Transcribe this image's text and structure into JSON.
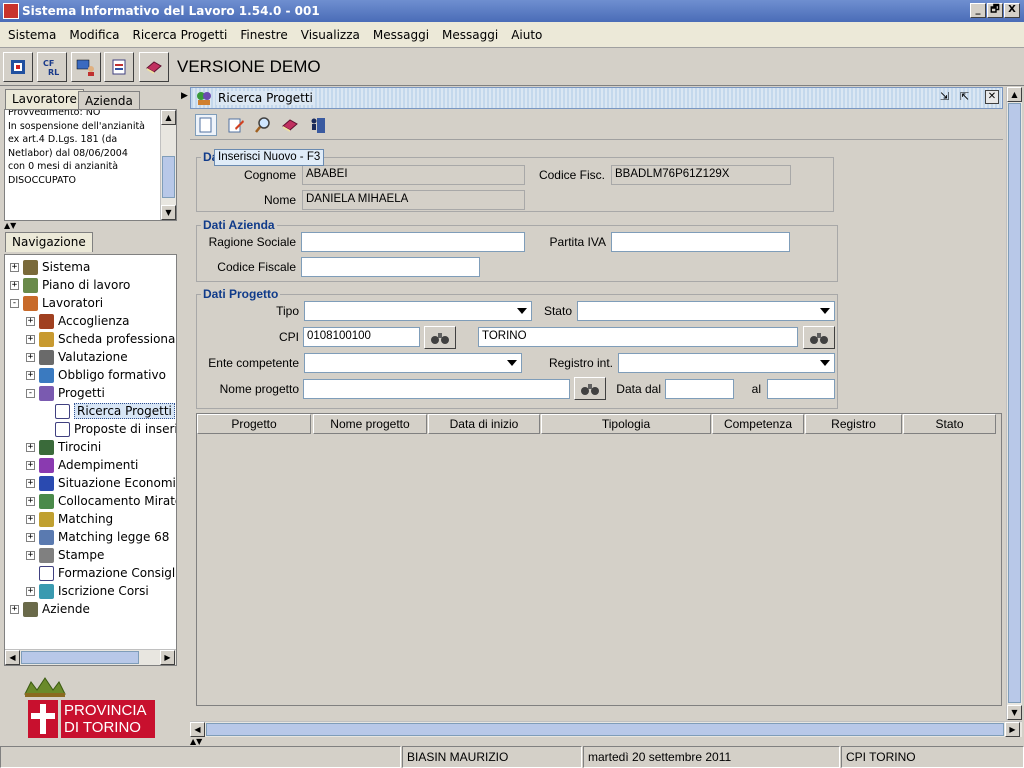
{
  "window": {
    "title": "Sistema Informativo del Lavoro 1.54.0 - 001",
    "minimize": "_",
    "maximize": "🗗",
    "close": "X"
  },
  "menu": [
    "Sistema",
    "Modifica",
    "Ricerca Progetti",
    "Finestre",
    "Visualizza",
    "Messaggi",
    "Messaggi",
    "Aiuto"
  ],
  "toolbar": {
    "version_label": "VERSIONE DEMO",
    "icons": [
      "network-icon",
      "cf-icon",
      "screen-user-icon",
      "document-icon",
      "book-icon"
    ]
  },
  "info_panel": {
    "tabs": [
      "Lavoratore",
      "Azienda"
    ],
    "text_lines": [
      "Provvedimento: NO",
      "In sospensione dell'anzianità",
      "ex art.4 D.Lgs. 181 (da",
      "Netlabor) dal 08/06/2004",
      "con 0 mesi di anzianità",
      "DISOCCUPATO"
    ]
  },
  "navigation": {
    "tab": "Navigazione",
    "items": [
      {
        "label": "Sistema",
        "level": 0,
        "expand": "+",
        "color": "#7a6a3a"
      },
      {
        "label": "Piano di lavoro",
        "level": 0,
        "expand": "+",
        "color": "#6a8a4a"
      },
      {
        "label": "Lavoratori",
        "level": 0,
        "expand": "-",
        "color": "#c86a2a"
      },
      {
        "label": "Accoglienza",
        "level": 1,
        "expand": "+",
        "color": "#a04020"
      },
      {
        "label": "Scheda professionale",
        "level": 1,
        "expand": "+",
        "color": "#c89a30"
      },
      {
        "label": "Valutazione",
        "level": 1,
        "expand": "+",
        "color": "#6a6a6a"
      },
      {
        "label": "Obbligo formativo",
        "level": 1,
        "expand": "+",
        "color": "#3a7ac0"
      },
      {
        "label": "Progetti",
        "level": 1,
        "expand": "-",
        "color": "#7a5ab0"
      },
      {
        "label": "Ricerca Progetti",
        "level": 2,
        "expand": "",
        "color": "#ffffff",
        "selected": true
      },
      {
        "label": "Proposte di inserimento",
        "level": 2,
        "expand": "",
        "color": "#ffffff"
      },
      {
        "label": "Tirocini",
        "level": 1,
        "expand": "+",
        "color": "#3a6a3a"
      },
      {
        "label": "Adempimenti",
        "level": 1,
        "expand": "+",
        "color": "#8a3ab0"
      },
      {
        "label": "Situazione Economica",
        "level": 1,
        "expand": "+",
        "color": "#2a4ab0"
      },
      {
        "label": "Collocamento Mirato",
        "level": 1,
        "expand": "+",
        "color": "#4a8a4a"
      },
      {
        "label": "Matching",
        "level": 1,
        "expand": "+",
        "color": "#c0a030"
      },
      {
        "label": "Matching legge 68",
        "level": 1,
        "expand": "+",
        "color": "#5a7ab0"
      },
      {
        "label": "Stampe",
        "level": 1,
        "expand": "+",
        "color": "#808080"
      },
      {
        "label": "Formazione Consigliata",
        "level": 1,
        "expand": "",
        "color": "#ffffff"
      },
      {
        "label": "Iscrizione Corsi",
        "level": 1,
        "expand": "+",
        "color": "#3a9ab0"
      },
      {
        "label": "Aziende",
        "level": 0,
        "expand": "+",
        "color": "#6a6a4a"
      }
    ]
  },
  "logo": {
    "line1": "PROVINCIA",
    "line2": "DI TORINO"
  },
  "ricerca": {
    "frame_title": "Ricerca Progetti",
    "tooltip": "Inserisci Nuovo - F3",
    "dati_lavoratore": {
      "legend": "Da",
      "cognome_label": "Cognome",
      "cognome": "ABABEI",
      "codice_fisc_label": "Codice Fisc.",
      "codice_fisc": "BBADLM76P61Z129X",
      "nome_label": "Nome",
      "nome": "DANIELA MIHAELA"
    },
    "dati_azienda": {
      "legend": "Dati Azienda",
      "ragione_sociale_label": "Ragione Sociale",
      "ragione_sociale": "",
      "partita_iva_label": "Partita IVA",
      "partita_iva": "",
      "codice_fiscale_label": "Codice Fiscale",
      "codice_fiscale": ""
    },
    "dati_progetto": {
      "legend": "Dati Progetto",
      "tipo_label": "Tipo",
      "tipo": "",
      "stato_label": "Stato",
      "stato": "",
      "cpi_label": "CPI",
      "cpi_code": "0108100100",
      "cpi_name": "TORINO",
      "ente_label": "Ente competente",
      "ente": "",
      "registro_label": "Registro int.",
      "registro": "",
      "nome_progetto_label": "Nome progetto",
      "nome_progetto": "",
      "data_dal_label": "Data dal",
      "data_dal": "",
      "al_label": "al",
      "al": ""
    },
    "table_columns": [
      "Progetto",
      "Nome progetto",
      "Data di inizio",
      "Tipologia",
      "Competenza",
      "Registro",
      "Stato"
    ]
  },
  "status_bar": {
    "user": "BIASIN MAURIZIO",
    "date": "martedì 20 settembre 2011",
    "cpi": "CPI TORINO"
  }
}
